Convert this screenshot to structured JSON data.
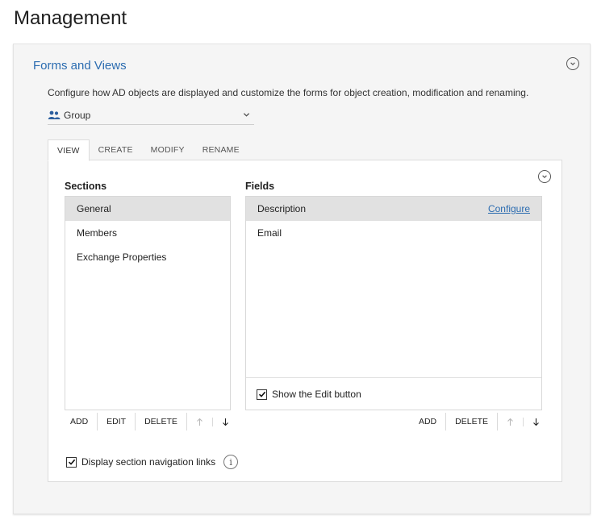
{
  "page": {
    "title": "Management"
  },
  "card": {
    "title": "Forms and Views",
    "description": "Configure how AD objects are displayed and customize the forms for object creation, modification and renaming.",
    "object_type": {
      "selected": "Group",
      "icon": "group-icon"
    }
  },
  "tabs": [
    {
      "label": "VIEW",
      "active": true
    },
    {
      "label": "CREATE",
      "active": false
    },
    {
      "label": "MODIFY",
      "active": false
    },
    {
      "label": "RENAME",
      "active": false
    }
  ],
  "sections": {
    "label": "Sections",
    "items": [
      {
        "label": "General",
        "selected": true
      },
      {
        "label": "Members",
        "selected": false
      },
      {
        "label": "Exchange Properties",
        "selected": false
      }
    ],
    "toolbar": {
      "add": "ADD",
      "edit": "EDIT",
      "delete": "DELETE"
    }
  },
  "fields": {
    "label": "Fields",
    "items": [
      {
        "label": "Description",
        "selected": true,
        "link": "Configure"
      },
      {
        "label": "Email",
        "selected": false
      }
    ],
    "show_edit_button": {
      "label": "Show the Edit button",
      "checked": true
    },
    "toolbar": {
      "add": "ADD",
      "delete": "DELETE"
    }
  },
  "display_nav_links": {
    "label": "Display section navigation links",
    "checked": true,
    "info": "i"
  },
  "colors": {
    "accent": "#2b6cb0",
    "selected_row": "#e1e1e1",
    "card_bg": "#f5f5f5"
  }
}
